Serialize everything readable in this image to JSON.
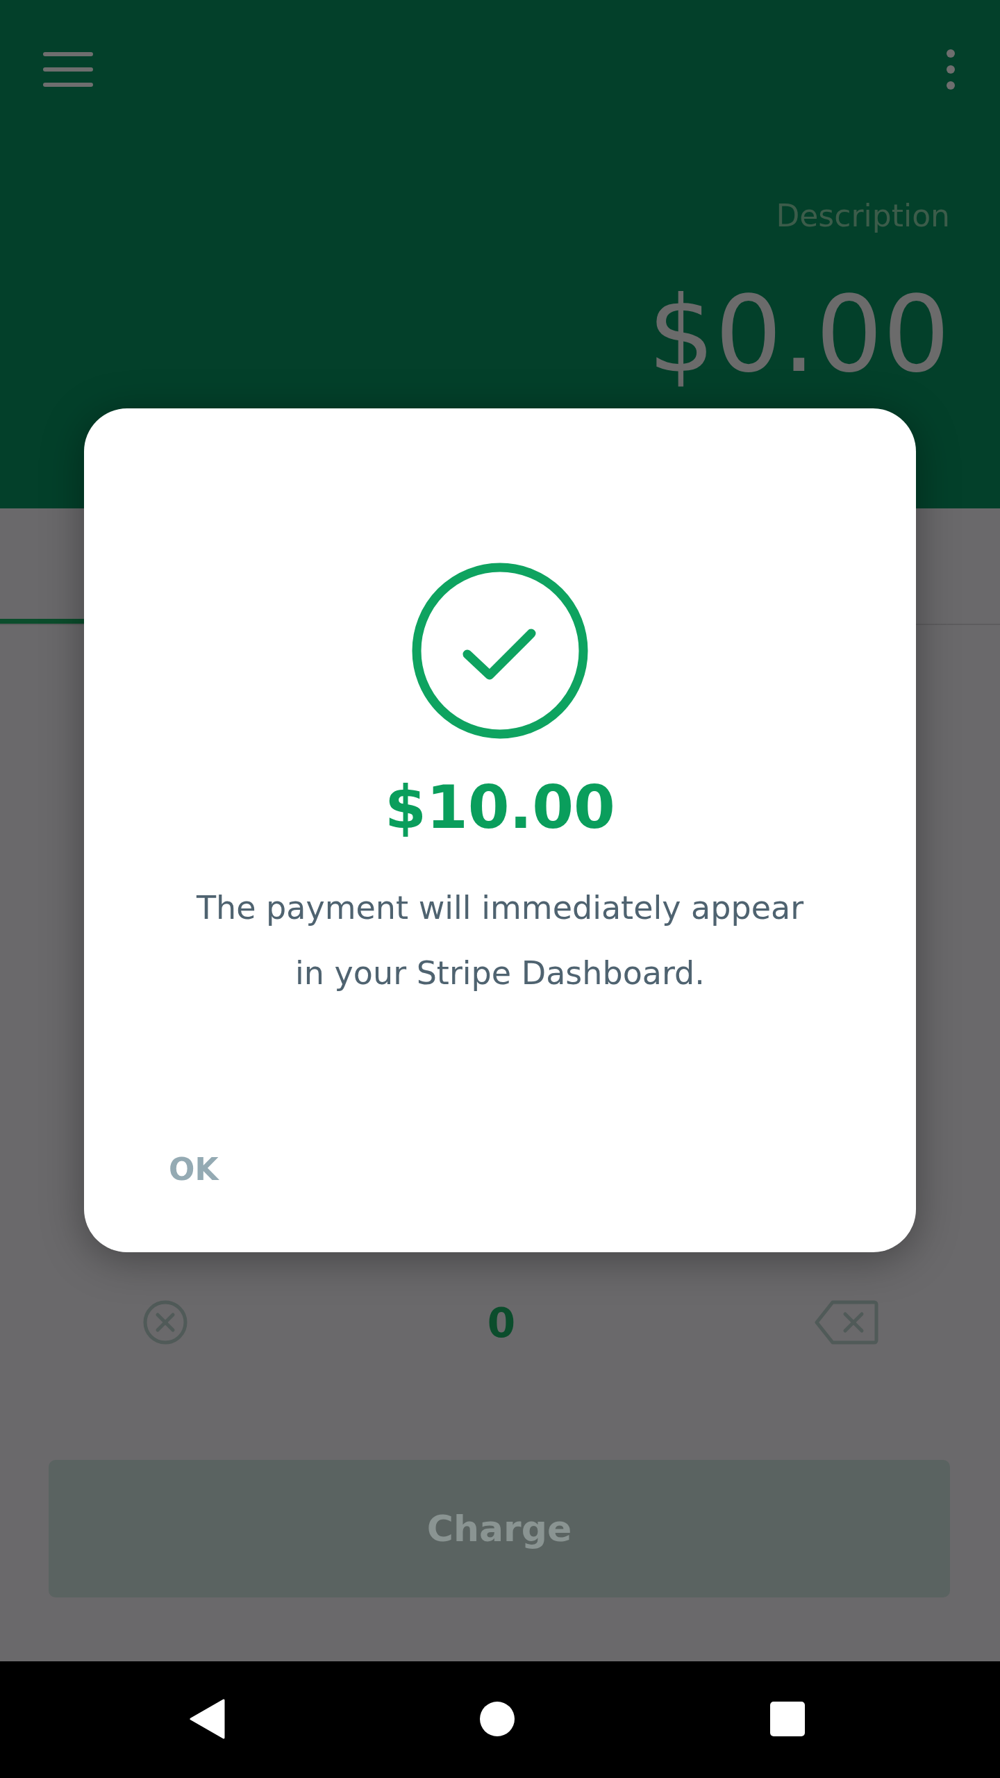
{
  "top_bar": {
    "description_placeholder": "Description",
    "amount": "$0.00"
  },
  "keypad": {
    "display": "0"
  },
  "charge_button": {
    "label": "Charge",
    "disabled": true
  },
  "dialog": {
    "amount": "$10.00",
    "message": "The payment will immediately appear in your Stripe Dashboard.",
    "button": "OK"
  }
}
